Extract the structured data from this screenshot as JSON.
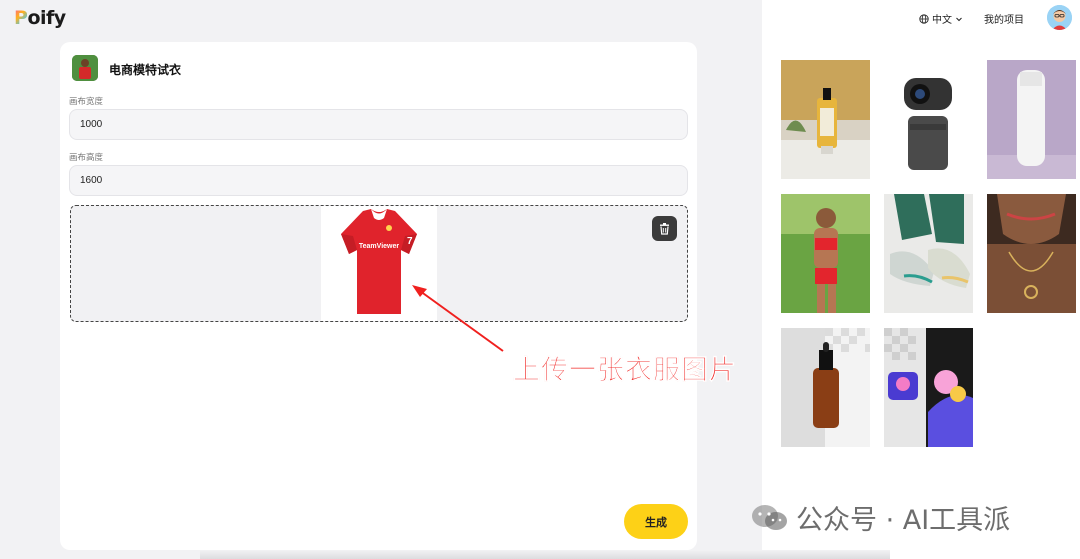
{
  "app": {
    "logo_first": "P",
    "logo_rest": "oify"
  },
  "header": {
    "language": "中文",
    "projects": "我的项目",
    "avatar_icon": "user-avatar"
  },
  "panel": {
    "title": "电商模特试衣",
    "width": {
      "label": "画布宽度",
      "value": "1000"
    },
    "height": {
      "label": "画布高度",
      "value": "1600"
    },
    "upload": {
      "image": "red-football-shirt",
      "shirt_text": "TeamViewer",
      "delete_icon": "trash-icon"
    },
    "generate_label": "生成"
  },
  "gallery": [
    {
      "name": "serum-bottle-on-table"
    },
    {
      "name": "webcam-device"
    },
    {
      "name": "white-water-bottle"
    },
    {
      "name": "woman-running"
    },
    {
      "name": "sneakers-closeup"
    },
    {
      "name": "gold-necklace-model"
    },
    {
      "name": "amber-dropper-bottle"
    },
    {
      "name": "colorful-sneaker-art"
    }
  ],
  "annotation": "上传一张衣服图片",
  "watermark": "公众号 · AI工具派",
  "colors": {
    "accent": "#fdd117",
    "annotation": "#f0201e",
    "panel": "#ffffff",
    "background": "#f2f2f4"
  }
}
